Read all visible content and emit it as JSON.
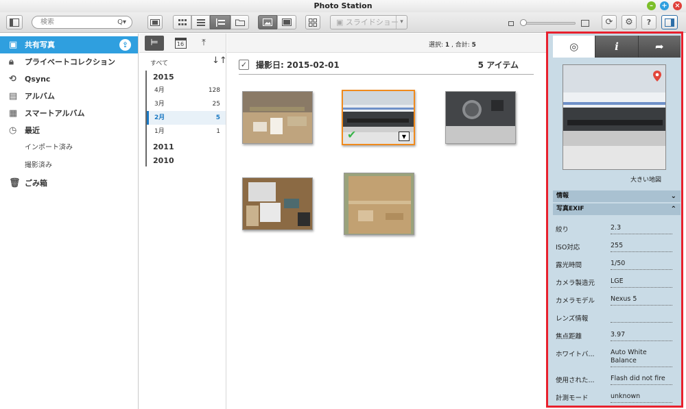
{
  "window": {
    "title": "Photo Station"
  },
  "toolbar": {
    "search_placeholder": "検索",
    "search_icon": "Q▾",
    "slideshow_label": "スライドショー"
  },
  "sidebar": {
    "items": [
      {
        "label": "共有写真",
        "icon": "photo-icon",
        "active": true
      },
      {
        "label": "プライベートコレクション",
        "icon": "lock-icon"
      },
      {
        "label": "Qsync",
        "icon": "sync-icon"
      },
      {
        "label": "アルバム",
        "icon": "album-icon"
      },
      {
        "label": "スマートアルバム",
        "icon": "smart-album-icon"
      },
      {
        "label": "最近",
        "icon": "clock-icon"
      }
    ],
    "recent_sub": [
      "インポート済み",
      "撮影済み"
    ],
    "trash": {
      "label": "ごみ箱",
      "icon": "trash-icon"
    }
  },
  "timeline": {
    "all_label": "すべて",
    "sort_icon": "↓↑",
    "calendar_day": "16",
    "years": [
      {
        "year": "2015",
        "months": [
          {
            "label": "4月",
            "count": "128"
          },
          {
            "label": "3月",
            "count": "25"
          },
          {
            "label": "2月",
            "count": "5",
            "active": true
          },
          {
            "label": "1月",
            "count": "1"
          }
        ]
      },
      {
        "year": "2011"
      },
      {
        "year": "2010"
      }
    ]
  },
  "main": {
    "selection_label": "選択: ",
    "selection_count": "1",
    "total_label": " , 合計: ",
    "total_count": "5",
    "group_title": "撮影日: 2015-02-01",
    "group_count": "5 アイテム",
    "thumbnails": [
      {
        "name": "photo-1"
      },
      {
        "name": "photo-2",
        "selected": true
      },
      {
        "name": "photo-3"
      },
      {
        "name": "photo-4"
      },
      {
        "name": "photo-5"
      }
    ]
  },
  "panel": {
    "tabs": [
      {
        "icon": "camera-icon",
        "glyph": "◎"
      },
      {
        "icon": "info-icon",
        "glyph": "i"
      },
      {
        "icon": "share-icon",
        "glyph": "➦"
      }
    ],
    "map_link": "大きい地図",
    "sections": {
      "info": "情報",
      "exif": "写真EXIF"
    },
    "exif": [
      {
        "label": "絞り",
        "value": "2.3"
      },
      {
        "label": "ISO対応",
        "value": "255"
      },
      {
        "label": "露光時間",
        "value": "1/50"
      },
      {
        "label": "カメラ製造元",
        "value": "LGE"
      },
      {
        "label": "カメラモデル",
        "value": "Nexus 5"
      },
      {
        "label": "レンズ情報",
        "value": ""
      },
      {
        "label": "焦点距離",
        "value": "3.97"
      },
      {
        "label": "ホワイトバ...",
        "value": "Auto White Balance"
      },
      {
        "label": "使用された...",
        "value": "Flash did not fire"
      },
      {
        "label": "計測モード",
        "value": "unknown"
      }
    ]
  },
  "colors": {
    "accent": "#2f9fdf",
    "selection_border": "#f08a1c",
    "highlight_frame": "#e8202d",
    "panel_bg": "#c9dbe6"
  }
}
